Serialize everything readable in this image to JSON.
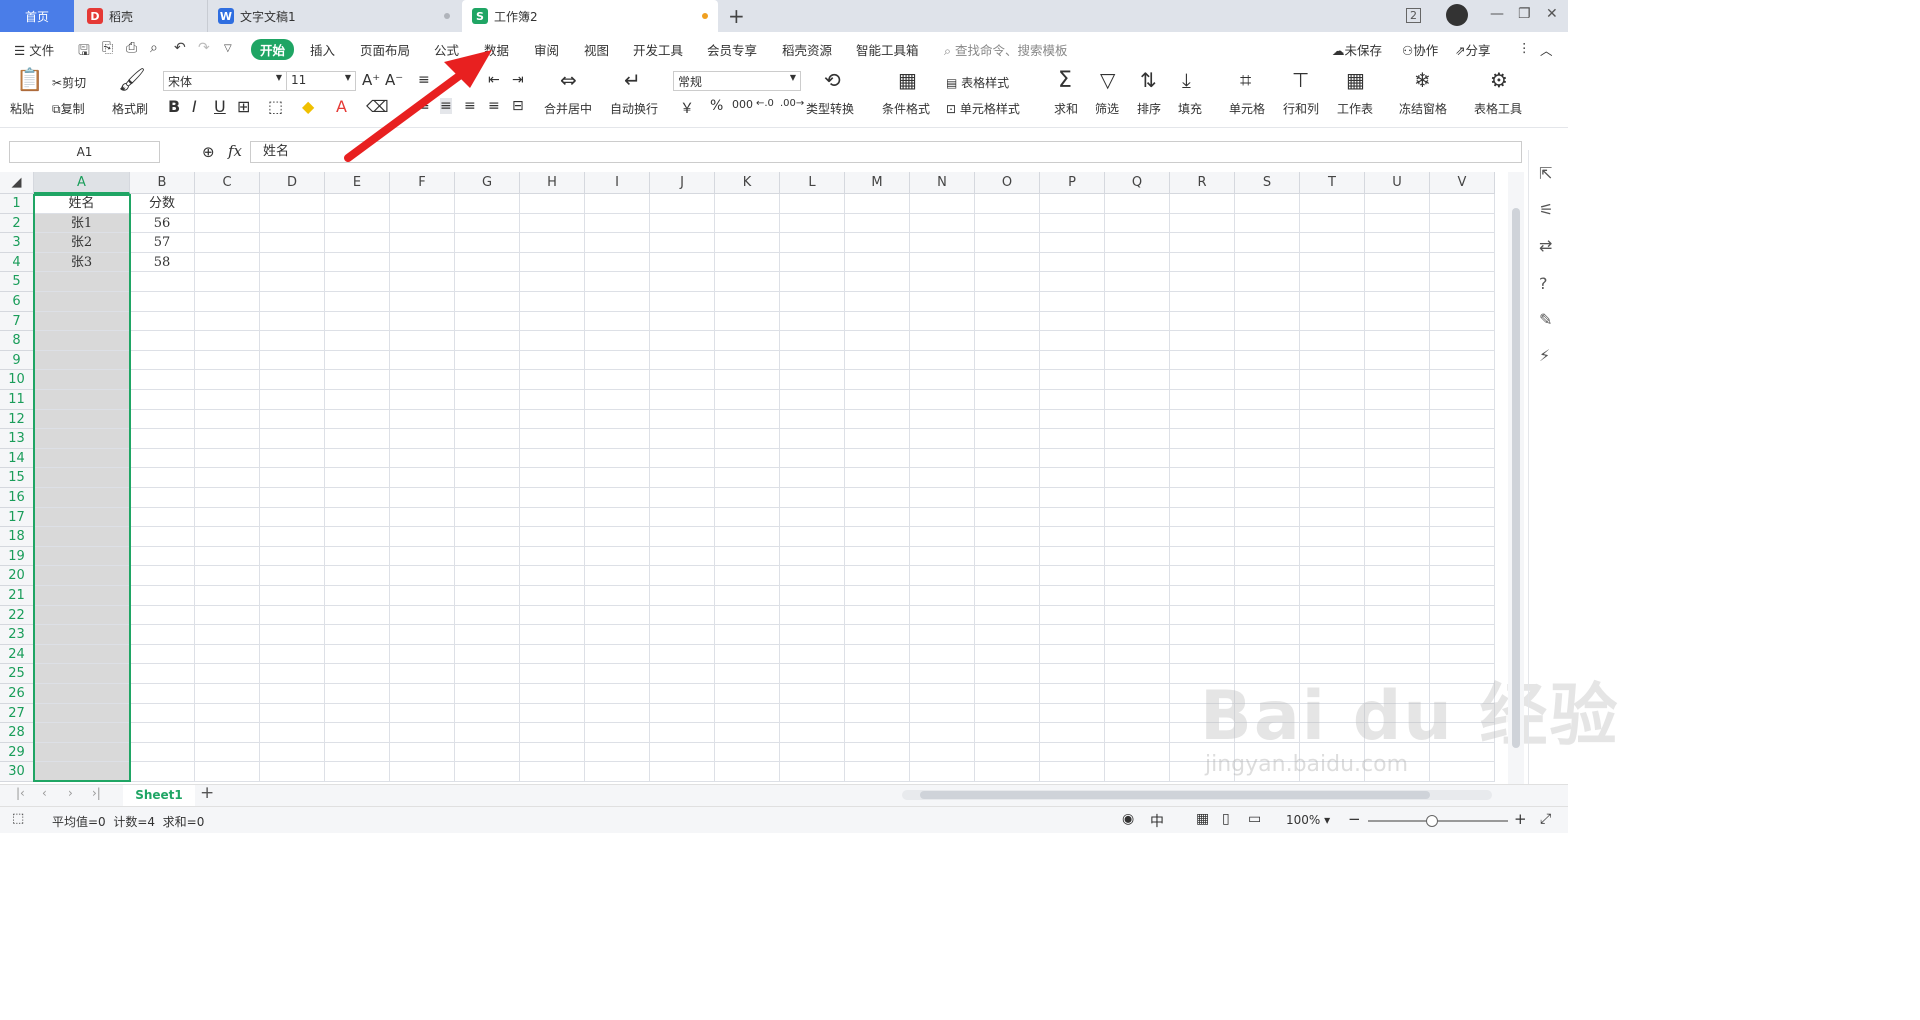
{
  "tabs": {
    "home": "首页",
    "tab1": "稻壳",
    "tab2": "文字文稿1",
    "tab3": "工作簿2",
    "window_badge": "2"
  },
  "menu": {
    "file": "文件",
    "items": [
      "开始",
      "插入",
      "页面布局",
      "公式",
      "数据",
      "审阅",
      "视图",
      "开发工具",
      "会员专享",
      "稻壳资源",
      "智能工具箱"
    ],
    "search": "查找命令、搜索模板",
    "unsaved": "未保存",
    "collab": "协作",
    "share": "分享"
  },
  "ribbon": {
    "paste": "粘贴",
    "cut": "剪切",
    "copy": "复制",
    "format_painter": "格式刷",
    "font": "宋体",
    "size": "11",
    "merge_center": "合并居中",
    "wrap": "自动换行",
    "number_format": "常规",
    "type_convert": "类型转换",
    "cond_format": "条件格式",
    "table_style": "表格样式",
    "cell_style": "单元格样式",
    "sum": "求和",
    "filter": "筛选",
    "sort": "排序",
    "fill": "填充",
    "cell": "单元格",
    "row_col": "行和列",
    "worksheet": "工作表",
    "freeze": "冻结窗格",
    "table_tools": "表格工具",
    "currency": "￥",
    "percent": "%",
    "thousands": "000"
  },
  "formula_bar": {
    "name_box": "A1",
    "fx": "fx",
    "content": "姓名"
  },
  "columns": [
    "A",
    "B",
    "C",
    "D",
    "E",
    "F",
    "G",
    "H",
    "I",
    "J",
    "K",
    "L",
    "M",
    "N",
    "O",
    "P",
    "Q",
    "R",
    "S",
    "T",
    "U",
    "V"
  ],
  "rows": [
    "1",
    "2",
    "3",
    "4",
    "5",
    "6",
    "7",
    "8",
    "9",
    "10",
    "11",
    "12",
    "13",
    "14",
    "15",
    "16",
    "17",
    "18",
    "19",
    "20",
    "21",
    "22",
    "23",
    "24",
    "25",
    "26",
    "27",
    "28",
    "29",
    "30"
  ],
  "cells": {
    "A1": "姓名",
    "B1": "分数",
    "A2": "张1",
    "B2": "56",
    "A3": "张2",
    "B3": "57",
    "A4": "张3",
    "B4": "58"
  },
  "sheet": {
    "name": "Sheet1"
  },
  "status": {
    "stats": "平均值=0  计数=4  求和=0",
    "zoom": "100%"
  },
  "watermark": {
    "brand": "Bai du 经验",
    "url": "jingyan.baidu.com"
  },
  "colors": {
    "accent": "#1fa564",
    "home_tab": "#4a7de8",
    "arrow": "#e82020",
    "selection": "#d9d9d9"
  }
}
